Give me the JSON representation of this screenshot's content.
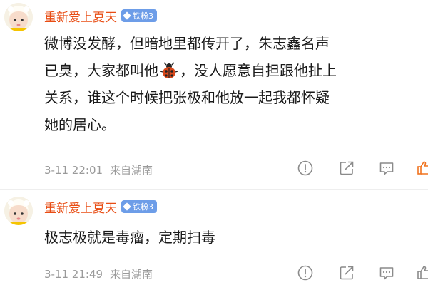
{
  "comments": [
    {
      "username": "重新爱上夏天",
      "badge": "铁粉3",
      "lines": [
        "微博没发酵，但暗地里都传开了，朱志鑫名声",
        "已臭，大家都叫他",
        "，没人愿意自担跟他扯上",
        "关系，谁这个时候把张极和他放一起我都怀疑",
        "她的居心。"
      ],
      "emoji_icon": "ladybug-icon",
      "timestamp": "3-11 22:01",
      "location": "来自湖南"
    },
    {
      "username": "重新爱上夏天",
      "badge": "铁粉3",
      "lines": [
        "极志极就是毒瘤，定期扫毒"
      ],
      "timestamp": "3-11 21:49",
      "location": "来自湖南"
    }
  ],
  "actions": [
    "report-icon",
    "share-icon",
    "comment-icon",
    "like-icon"
  ],
  "colors": {
    "username": "#e84d14",
    "badge_bg": "#6d9de8",
    "text": "#1a1a1a",
    "meta": "#9a9a9a",
    "icon": "#8a8a8a",
    "like_accent": "#f0731f"
  }
}
